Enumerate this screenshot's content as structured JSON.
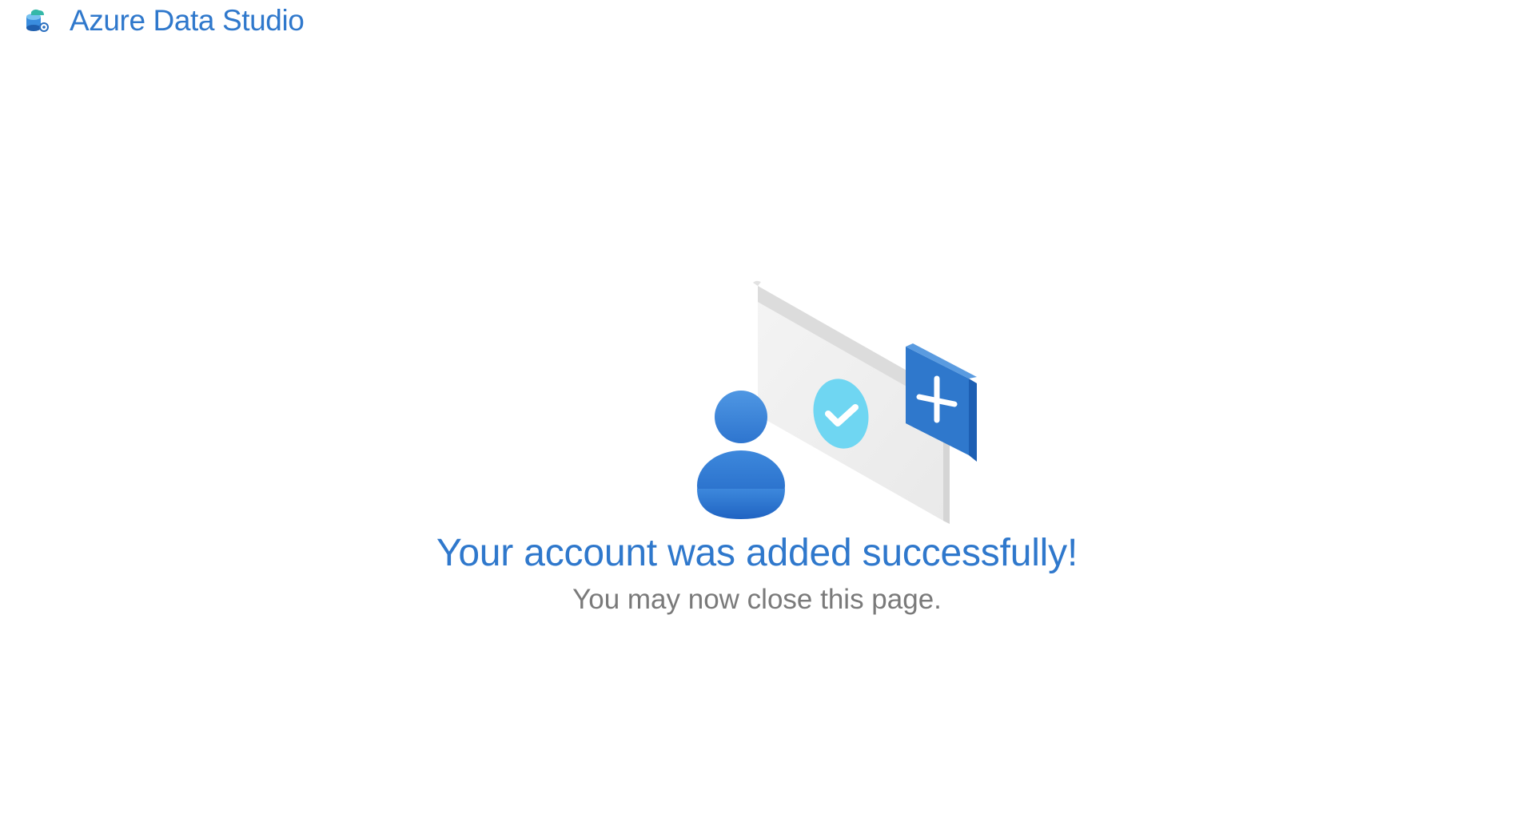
{
  "header": {
    "logo_icon": "azure-data-studio-logo",
    "app_name": "Azure Data Studio"
  },
  "illustration": {
    "icon": "account-added-illustration",
    "accent_color": "#2f78cc",
    "check_color": "#6fd6f2"
  },
  "main": {
    "title": "Your account was added successfully!",
    "subtitle": "You may now close this page."
  }
}
